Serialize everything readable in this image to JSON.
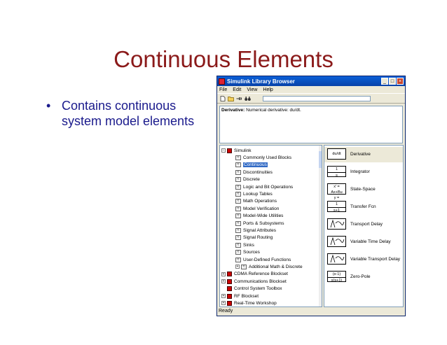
{
  "slide": {
    "title": "Continuous Elements",
    "bullet": "Contains continuous system model elements"
  },
  "window": {
    "title": "Simulink Library Browser",
    "menus": [
      "File",
      "Edit",
      "View",
      "Help"
    ],
    "description_label": "Derivative:",
    "description_text": "Numerical derivative:  du/dt.",
    "status": "Ready",
    "tree": [
      {
        "label": "Simulink",
        "level": 0,
        "expander": "−",
        "icon": "lib"
      },
      {
        "label": "Commonly Used Blocks",
        "level": 1,
        "icon": "sub"
      },
      {
        "label": "Continuous",
        "level": 1,
        "icon": "sub",
        "selected": true
      },
      {
        "label": "Discontinuities",
        "level": 1,
        "icon": "sub"
      },
      {
        "label": "Discrete",
        "level": 1,
        "icon": "sub"
      },
      {
        "label": "Logic and Bit Operations",
        "level": 1,
        "icon": "sub"
      },
      {
        "label": "Lookup Tables",
        "level": 1,
        "icon": "sub"
      },
      {
        "label": "Math Operations",
        "level": 1,
        "icon": "sub"
      },
      {
        "label": "Model Verification",
        "level": 1,
        "icon": "sub"
      },
      {
        "label": "Model-Wide Utilities",
        "level": 1,
        "icon": "sub"
      },
      {
        "label": "Ports & Subsystems",
        "level": 1,
        "icon": "sub"
      },
      {
        "label": "Signal Attributes",
        "level": 1,
        "icon": "sub"
      },
      {
        "label": "Signal Routing",
        "level": 1,
        "icon": "sub"
      },
      {
        "label": "Sinks",
        "level": 1,
        "icon": "sub"
      },
      {
        "label": "Sources",
        "level": 1,
        "icon": "sub"
      },
      {
        "label": "User-Defined Functions",
        "level": 1,
        "icon": "sub"
      },
      {
        "label": "Additional Math & Discrete",
        "level": 1,
        "expander": "+",
        "icon": "sub"
      },
      {
        "label": "CDMA Reference Blockset",
        "level": 0,
        "expander": "+",
        "icon": "lib"
      },
      {
        "label": "Communications Blockset",
        "level": 0,
        "expander": "+",
        "icon": "lib"
      },
      {
        "label": "Control System Toolbox",
        "level": 0,
        "icon": "lib"
      },
      {
        "label": "RF Blockset",
        "level": 0,
        "expander": "+",
        "icon": "lib"
      },
      {
        "label": "Real-Time Workshop",
        "level": 0,
        "expander": "+",
        "icon": "lib"
      }
    ],
    "blocks": [
      {
        "name": "Derivative",
        "icon_lines": [
          "du/dt"
        ],
        "selected": true
      },
      {
        "name": "Integrator",
        "icon_lines": [
          "1",
          "s"
        ]
      },
      {
        "name": "State-Space",
        "icon_lines": [
          "x' = Ax+Bu",
          "y = Cx+Du"
        ]
      },
      {
        "name": "Transfer Fcn",
        "icon_lines": [
          "1",
          "s+1"
        ]
      },
      {
        "name": "Transport Delay",
        "icon_lines": []
      },
      {
        "name": "Variable Time Delay",
        "icon_lines": []
      },
      {
        "name": "Variable Transport Delay",
        "icon_lines": []
      },
      {
        "name": "Zero-Pole",
        "icon_lines": [
          "(s-1)",
          "s(s+1)"
        ]
      }
    ]
  }
}
